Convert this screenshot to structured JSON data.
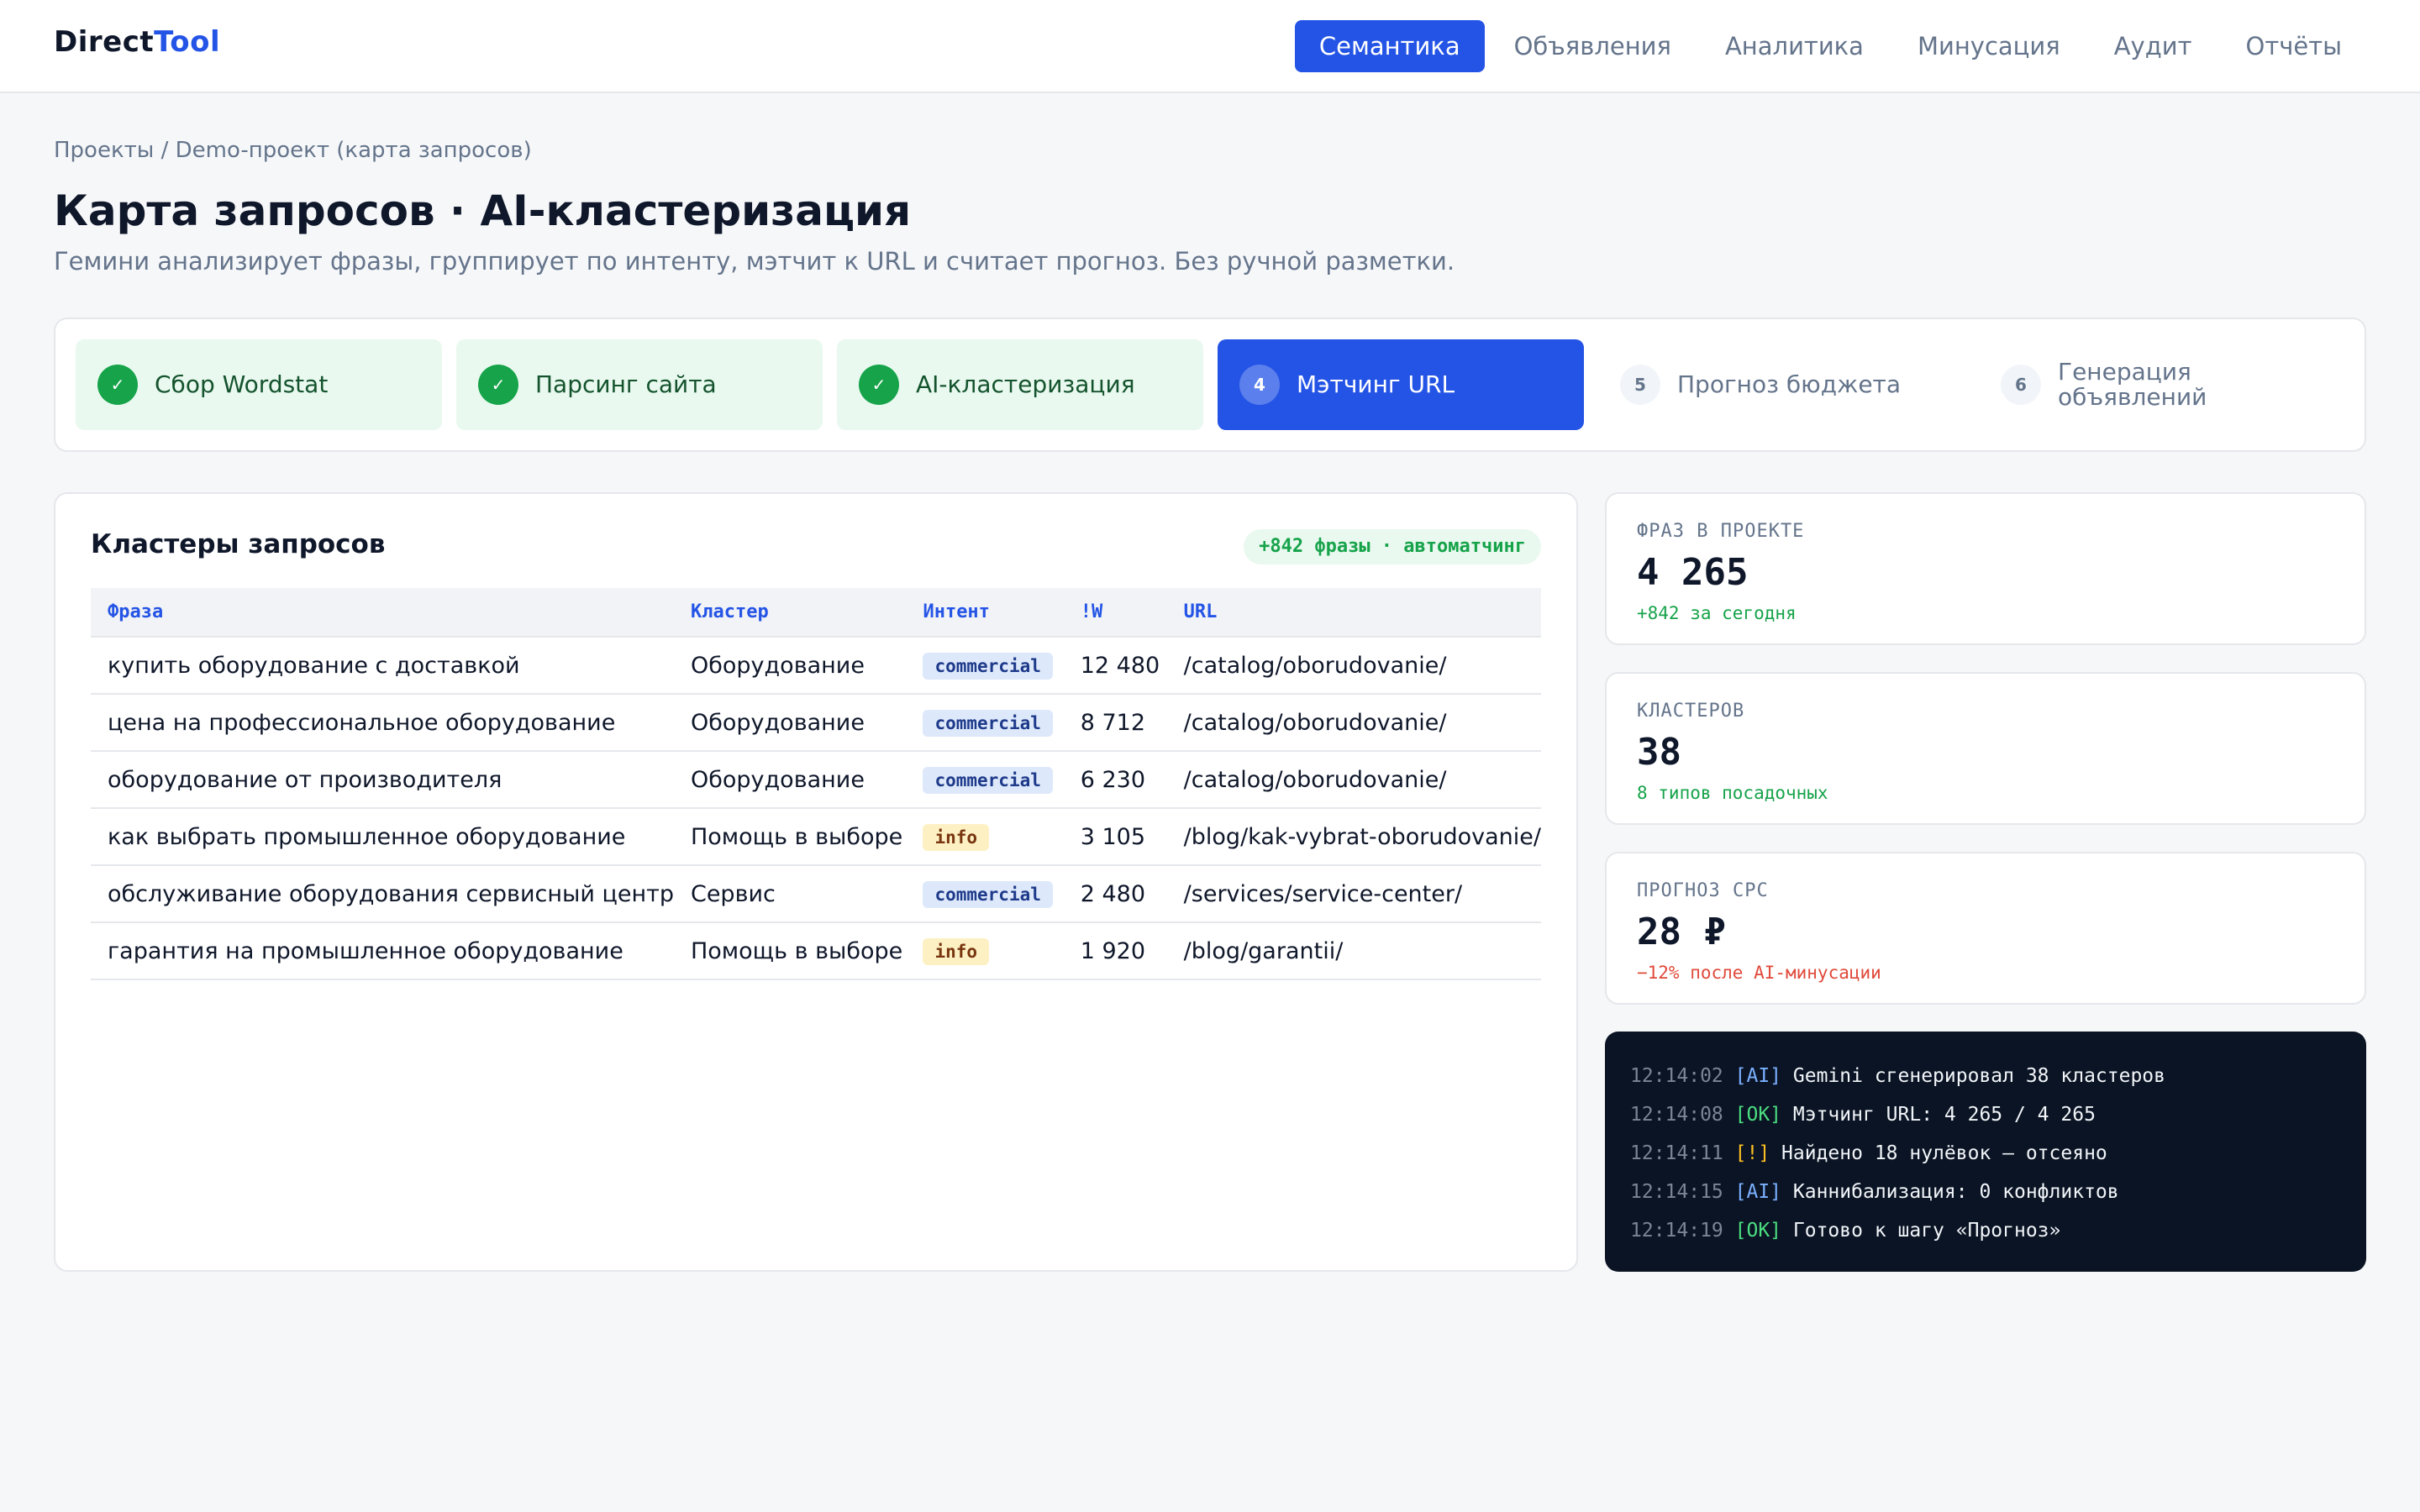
{
  "app": {
    "logo_part1": "Direct",
    "logo_part2": "Tool"
  },
  "nav": [
    {
      "label": "Семантика",
      "active": true
    },
    {
      "label": "Объявления",
      "active": false
    },
    {
      "label": "Аналитика",
      "active": false
    },
    {
      "label": "Минусация",
      "active": false
    },
    {
      "label": "Аудит",
      "active": false
    },
    {
      "label": "Отчёты",
      "active": false
    }
  ],
  "header": {
    "breadcrumb": "Проекты / Demo-проект (карта запросов)",
    "title": "Карта запросов · AI-кластеризация",
    "subtitle": "Гемини анализирует фразы, группирует по интенту, мэтчит к URL и считает прогноз. Без ручной разметки."
  },
  "steps": [
    {
      "marker": "✓",
      "label": "Сбор Wordstat",
      "state": "done"
    },
    {
      "marker": "✓",
      "label": "Парсинг сайта",
      "state": "done"
    },
    {
      "marker": "✓",
      "label": "AI-кластеризация",
      "state": "done"
    },
    {
      "marker": "4",
      "label": "Мэтчинг URL",
      "state": "current"
    },
    {
      "marker": "5",
      "label": "Прогноз бюджета",
      "state": "todo"
    },
    {
      "marker": "6",
      "label": "Генерация объявлений",
      "state": "todo"
    }
  ],
  "clusters": {
    "title": "Кластеры запросов",
    "badge": "+842 фразы · автоматчинг",
    "columns": {
      "phrase": "Фраза",
      "cluster": "Кластер",
      "intent": "Интент",
      "freq": "!W",
      "url": "URL"
    },
    "rows": [
      {
        "phrase": "купить оборудование с доставкой",
        "cluster": "Оборудование",
        "intent": "commercial",
        "freq": "12 480",
        "url": "/catalog/oborudovanie/"
      },
      {
        "phrase": "цена на профессиональное оборудование",
        "cluster": "Оборудование",
        "intent": "commercial",
        "freq": "8 712",
        "url": "/catalog/oborudovanie/"
      },
      {
        "phrase": "оборудование от производителя",
        "cluster": "Оборудование",
        "intent": "commercial",
        "freq": "6 230",
        "url": "/catalog/oborudovanie/"
      },
      {
        "phrase": "как выбрать промышленное оборудование",
        "cluster": "Помощь в выборе",
        "intent": "info",
        "freq": "3 105",
        "url": "/blog/kak-vybrat-oborudovanie/"
      },
      {
        "phrase": "обслуживание оборудования сервисный центр",
        "cluster": "Сервис",
        "intent": "commercial",
        "freq": "2 480",
        "url": "/services/service-center/"
      },
      {
        "phrase": "гарантия на промышленное оборудование",
        "cluster": "Помощь в выборе",
        "intent": "info",
        "freq": "1 920",
        "url": "/blog/garantii/"
      }
    ]
  },
  "metrics": [
    {
      "label": "ФРАЗ В ПРОЕКТЕ",
      "value": "4 265",
      "note": "+842 за сегодня",
      "tone": "green"
    },
    {
      "label": "КЛАСТЕРОВ",
      "value": "38",
      "note": "8 типов посадочных",
      "tone": "green"
    },
    {
      "label": "ПРОГНОЗ CPC",
      "value": "28 ₽",
      "note": "−12% после AI-минусации",
      "tone": "red"
    }
  ],
  "log": [
    {
      "time": "12:14:02",
      "level": "[AI]",
      "kind": "ai",
      "text": "Gemini сгенерировал 38 кластеров"
    },
    {
      "time": "12:14:08",
      "level": "[OK]",
      "kind": "ok",
      "text": "Мэтчинг URL: 4 265 / 4 265"
    },
    {
      "time": "12:14:11",
      "level": "[!]",
      "kind": "warn",
      "text": "Найдено 18 нулёвок — отсеяно"
    },
    {
      "time": "12:14:15",
      "level": "[AI]",
      "kind": "ai",
      "text": "Каннибализация: 0 конфликтов"
    },
    {
      "time": "12:14:19",
      "level": "[OK]",
      "kind": "ok",
      "text": "Готово к шагу «Прогноз»"
    }
  ],
  "colors": {
    "accent": "#2454e6",
    "success": "#16a34a",
    "danger": "#e04a3a",
    "warning": "#fbbf24",
    "console_bg": "#0b1424"
  }
}
